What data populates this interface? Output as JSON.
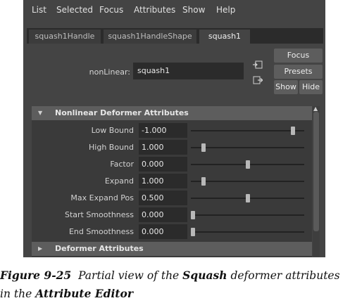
{
  "menubar": {
    "items": [
      "List",
      "Selected",
      "Focus",
      "Attributes",
      "Show",
      "Help"
    ]
  },
  "tabs": [
    {
      "label": "squash1Handle",
      "active": false
    },
    {
      "label": "squash1HandleShape",
      "active": false
    },
    {
      "label": "squash1",
      "active": true
    }
  ],
  "node": {
    "label": "nonLinear:",
    "value": "squash1"
  },
  "buttons": {
    "focus": "Focus",
    "presets": "Presets",
    "show": "Show",
    "hide": "Hide"
  },
  "icons": {
    "load_input": "input-connection-icon",
    "load_output": "output-connection-icon"
  },
  "sections": {
    "nonlinear": {
      "title": "Nonlinear Deformer Attributes",
      "expanded": true,
      "attributes": [
        {
          "label": "Low Bound",
          "value": "-1.000",
          "slider": 0.9
        },
        {
          "label": "High Bound",
          "value": "1.000",
          "slider": 0.11
        },
        {
          "label": "Factor",
          "value": "0.000",
          "slider": 0.5
        },
        {
          "label": "Expand",
          "value": "1.000",
          "slider": 0.11
        },
        {
          "label": "Max Expand Pos",
          "value": "0.500",
          "slider": 0.5
        },
        {
          "label": "Start Smoothness",
          "value": "0.000",
          "slider": 0.02
        },
        {
          "label": "End Smoothness",
          "value": "0.000",
          "slider": 0.02
        }
      ]
    },
    "deformer": {
      "title": "Deformer Attributes",
      "expanded": false
    }
  },
  "caption": {
    "figure": "Figure 9-25",
    "part1": "Partial view of the ",
    "bold1": "Squash",
    "part2": " deformer attributes in the ",
    "bold2": "Attribute Editor"
  },
  "colors": {
    "background": "#444444",
    "field": "#2b2b2b",
    "section_header": "#5d5d5d",
    "button": "#5d5d5d"
  }
}
